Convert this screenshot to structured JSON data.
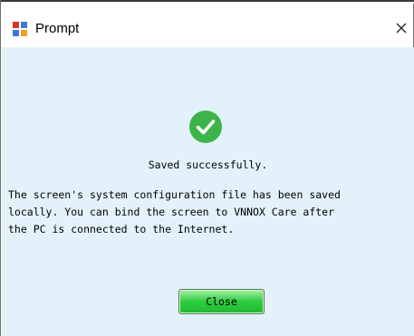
{
  "window": {
    "title": "Prompt"
  },
  "message": {
    "title": "Saved successfully.",
    "body": "The screen's system configuration file has been saved\nlocally. You can bind the screen to VNNOX Care after\nthe PC is connected to the Internet."
  },
  "buttons": {
    "close_label": "Close"
  },
  "icons": {
    "app": "app-icon",
    "close": "close-icon",
    "status": "success-check-icon"
  },
  "colors": {
    "content_bg": "#e3f2fa",
    "success": "#3cb449",
    "button_green": "#2ecc3f"
  }
}
